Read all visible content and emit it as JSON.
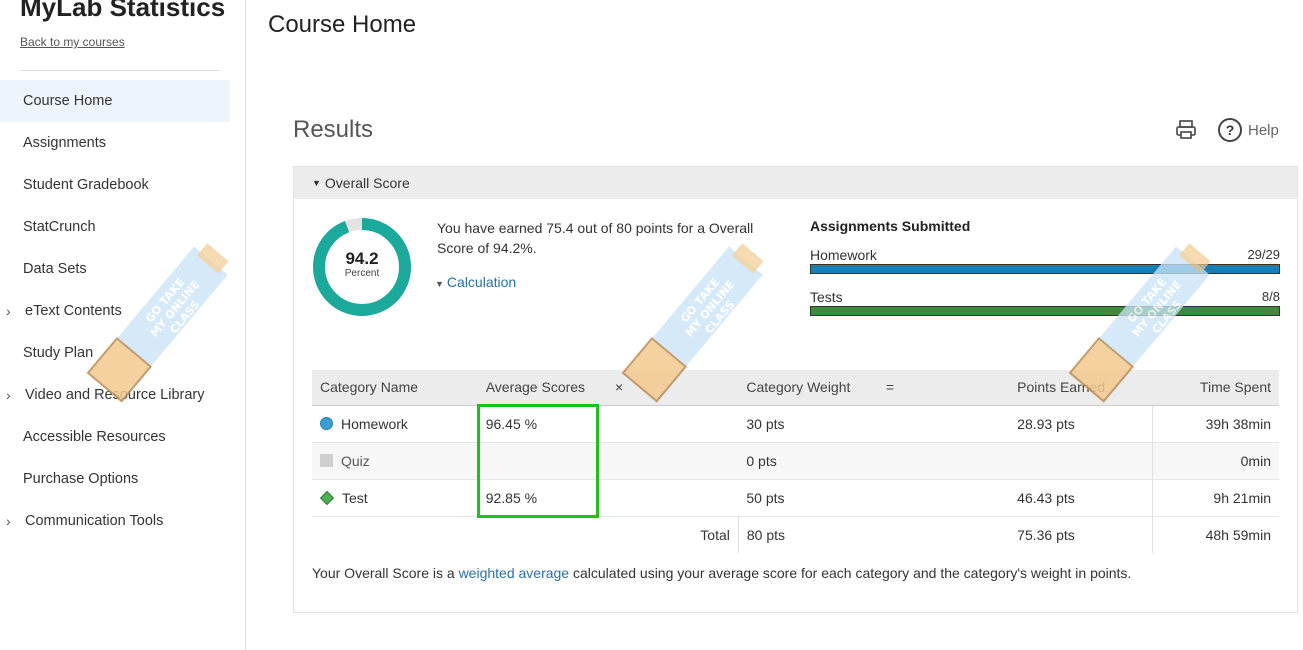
{
  "sidebar": {
    "app_title": "MyLab Statistics",
    "back_link": "Back to my courses",
    "items": [
      {
        "label": "Course Home",
        "active": true,
        "expandable": false
      },
      {
        "label": "Assignments",
        "active": false,
        "expandable": false
      },
      {
        "label": "Student Gradebook",
        "active": false,
        "expandable": false
      },
      {
        "label": "StatCrunch",
        "active": false,
        "expandable": false
      },
      {
        "label": "Data Sets",
        "active": false,
        "expandable": false
      },
      {
        "label": "eText Contents",
        "active": false,
        "expandable": true
      },
      {
        "label": "Study Plan",
        "active": false,
        "expandable": false
      },
      {
        "label": "Video and Resource Library",
        "active": false,
        "expandable": true
      },
      {
        "label": "Accessible Resources",
        "active": false,
        "expandable": false
      },
      {
        "label": "Purchase Options",
        "active": false,
        "expandable": false
      },
      {
        "label": "Communication Tools",
        "active": false,
        "expandable": true
      }
    ]
  },
  "page": {
    "title": "Course Home",
    "results_title": "Results",
    "help_label": "Help",
    "help_glyph": "?"
  },
  "overall": {
    "header": "Overall Score",
    "score_value": "94.2",
    "score_unit": "Percent",
    "score_fraction": 0.942,
    "earned_text": "You have earned 75.4 out of 80 points for a Overall Score of 94.2%.",
    "calculation_link": "Calculation"
  },
  "assignments": {
    "title": "Assignments Submitted",
    "rows": [
      {
        "label": "Homework",
        "value": "29/29",
        "fraction": 1.0,
        "color": "#1a7fb0"
      },
      {
        "label": "Tests",
        "value": "8/8",
        "fraction": 1.0,
        "color": "#3f8a3a"
      }
    ]
  },
  "table": {
    "headers": {
      "category": "Category Name",
      "average": "Average Scores",
      "times": "×",
      "weight": "Category Weight",
      "equals": "=",
      "points": "Points Earned",
      "time": "Time Spent"
    },
    "rows": [
      {
        "name": "Homework",
        "marker": "circle",
        "average": "96.45 %",
        "weight": "30 pts",
        "points": "28.93 pts",
        "time": "39h 38min"
      },
      {
        "name": "Quiz",
        "marker": "square",
        "average": "",
        "weight": "0 pts",
        "points": "",
        "time": "0min"
      },
      {
        "name": "Test",
        "marker": "diamond",
        "average": "92.85 %",
        "weight": "50 pts",
        "points": "46.43 pts",
        "time": "9h 21min"
      }
    ],
    "total": {
      "label": "Total",
      "weight": "80 pts",
      "points": "75.36 pts",
      "time": "48h 59min"
    }
  },
  "footnote": {
    "before": "Your Overall Score is a ",
    "link": "weighted average",
    "after": " calculated using your average score for each category and the category's weight in points."
  },
  "watermark": {
    "line1": "GO TAKE",
    "line2": "MY ONLINE",
    "line3": "CLASS"
  },
  "colors": {
    "donut": "#1aa99b",
    "donut_track": "#e3e3e3",
    "highlight": "#19c319"
  }
}
